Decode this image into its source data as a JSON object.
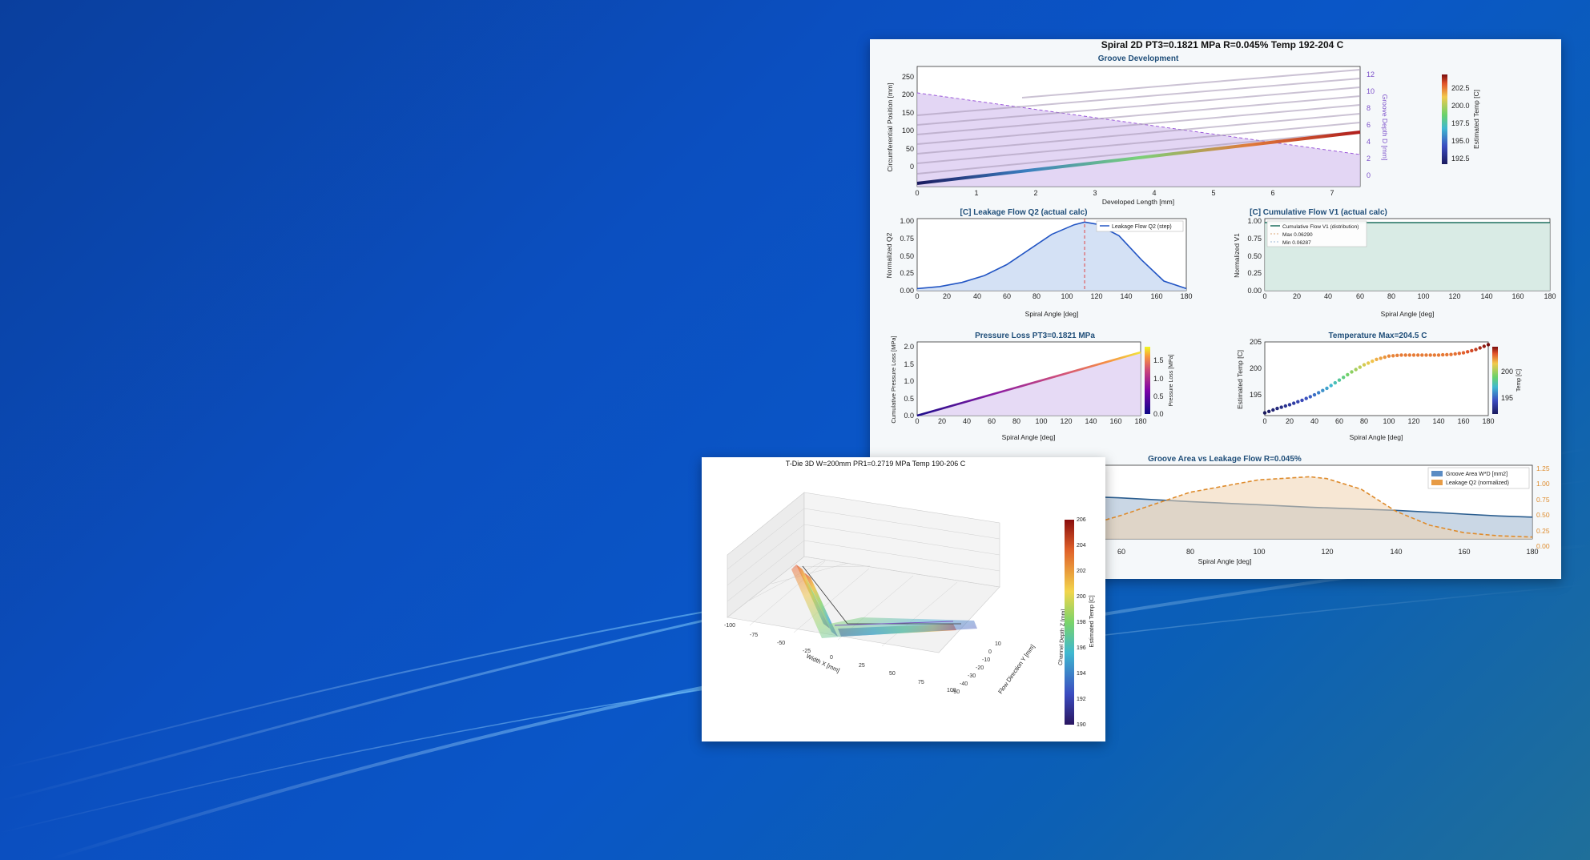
{
  "desktop": {
    "background": "#0b4fc0"
  },
  "spiral": {
    "title": "Spiral 2D  PT3=0.1821 MPa  R=0.045%  Temp 192-204 C",
    "groove": {
      "title": "Groove Development",
      "xlabel": "Developed Length [mm]",
      "ylabel": "Circumferential Position [mm]",
      "y2label": "Groove Depth D [mm]",
      "cbar_label": "Estimated Temp [C]",
      "xticks": [
        "0",
        "1",
        "2",
        "3",
        "4",
        "5",
        "6",
        "7"
      ],
      "yticks": [
        "0",
        "50",
        "100",
        "150",
        "200",
        "250"
      ],
      "y2ticks": [
        "0",
        "2",
        "4",
        "6",
        "8",
        "10",
        "12"
      ],
      "cbar_ticks": [
        "192.5",
        "195.0",
        "197.5",
        "200.0",
        "202.5"
      ]
    },
    "q2": {
      "title": "[C] Leakage Flow Q2 (actual calc)",
      "xlabel": "Spiral Angle [deg]",
      "ylabel": "Normalized Q2",
      "legend": "Leakage Flow Q2 (step)",
      "xticks": [
        "0",
        "20",
        "40",
        "60",
        "80",
        "100",
        "120",
        "140",
        "160",
        "180"
      ],
      "yticks": [
        "0.00",
        "0.25",
        "0.50",
        "0.75",
        "1.00"
      ]
    },
    "v1": {
      "title": "[C] Cumulative Flow V1 (actual calc)",
      "xlabel": "Spiral Angle [deg]",
      "ylabel": "Normalized V1",
      "legend": [
        "Cumulative Flow V1 (distribution)",
        "Max 0.06290",
        "Min 0.06287"
      ],
      "xticks": [
        "0",
        "20",
        "40",
        "60",
        "80",
        "100",
        "120",
        "140",
        "160",
        "180"
      ],
      "yticks": [
        "0.00",
        "0.25",
        "0.50",
        "0.75",
        "1.00"
      ]
    },
    "ploss": {
      "title": "Pressure Loss  PT3=0.1821 MPa",
      "xlabel": "Spiral Angle [deg]",
      "ylabel": "Cumulative Pressure Loss [MPa]",
      "cbar_label": "Pressure Loss [MPa]",
      "xticks": [
        "0",
        "20",
        "40",
        "60",
        "80",
        "100",
        "120",
        "140",
        "160",
        "180"
      ],
      "yticks": [
        "0.0",
        "0.5",
        "1.0",
        "1.5",
        "2.0"
      ],
      "cbar_ticks": [
        "0.0",
        "0.5",
        "1.0",
        "1.5"
      ]
    },
    "temp": {
      "title": "Temperature  Max=204.5 C",
      "xlabel": "Spiral Angle [deg]",
      "ylabel": "Estimated Temp [C]",
      "cbar_label": "Temp [C]",
      "xticks": [
        "0",
        "20",
        "40",
        "60",
        "80",
        "100",
        "120",
        "140",
        "160",
        "180"
      ],
      "yticks": [
        "195",
        "200",
        "205"
      ],
      "cbar_ticks": [
        "195",
        "200"
      ]
    },
    "area": {
      "title": "Groove Area vs Leakage Flow  R=0.045%",
      "xlabel": "Spiral Angle [deg]",
      "legend": [
        "Groove Area W*D [mm2]",
        "Leakage Q2 (normalized)"
      ],
      "xticks": [
        "60",
        "80",
        "100",
        "120",
        "140",
        "160",
        "180"
      ],
      "y2ticks": [
        "0.00",
        "0.25",
        "0.50",
        "0.75",
        "1.00",
        "1.25"
      ]
    }
  },
  "tdie": {
    "title": "T-Die 3D  W=200mm  PR1=0.2719 MPa  Temp 190-206 C",
    "xlabel": "Width X [mm]",
    "ylabel": "Flow Direction Y [mm]",
    "zlabel": "Channel Depth Z [mm]",
    "cbar_label": "Estimated Temp [C]",
    "xticks": [
      "-100",
      "-75",
      "-50",
      "-25",
      "0",
      "25",
      "50",
      "75",
      "100"
    ],
    "yticks": [
      "-50",
      "-40",
      "-30",
      "-20",
      "-10",
      "0",
      "10"
    ],
    "cbar_ticks": [
      "190",
      "192",
      "194",
      "196",
      "198",
      "200",
      "202",
      "204",
      "206"
    ]
  },
  "chart_data": [
    {
      "type": "line",
      "title": "[C] Leakage Flow Q2 (actual calc)",
      "xlabel": "Spiral Angle [deg]",
      "ylabel": "Normalized Q2",
      "x": [
        0,
        15,
        30,
        45,
        60,
        75,
        90,
        105,
        112,
        120,
        135,
        150,
        165,
        180
      ],
      "series": [
        {
          "name": "Leakage Flow Q2 (step)",
          "values": [
            0.03,
            0.06,
            0.12,
            0.22,
            0.38,
            0.6,
            0.82,
            0.96,
            1.0,
            0.97,
            0.8,
            0.45,
            0.14,
            0.03
          ]
        }
      ],
      "xlim": [
        0,
        180
      ],
      "ylim": [
        0,
        1.05
      ],
      "marker_x": 112
    },
    {
      "type": "line",
      "title": "[C] Cumulative Flow V1 (actual calc)",
      "xlabel": "Spiral Angle [deg]",
      "ylabel": "Normalized V1",
      "x": [
        0,
        180
      ],
      "series": [
        {
          "name": "Cumulative Flow V1 (distribution)",
          "values": [
            1.0,
            1.0
          ]
        }
      ],
      "xlim": [
        0,
        180
      ],
      "ylim": [
        0,
        1.05
      ]
    },
    {
      "type": "line",
      "title": "Pressure Loss  PT3=0.1821 MPa",
      "xlabel": "Spiral Angle [deg]",
      "ylabel": "Cumulative Pressure Loss [MPa]",
      "x": [
        0,
        180
      ],
      "series": [
        {
          "values": [
            0.0,
            1.85
          ]
        }
      ],
      "xlim": [
        0,
        180
      ],
      "ylim": [
        0,
        2.1
      ]
    },
    {
      "type": "scatter",
      "title": "Temperature  Max=204.5 C",
      "xlabel": "Spiral Angle [deg]",
      "ylabel": "Estimated Temp [C]",
      "x": [
        0,
        10,
        20,
        30,
        40,
        50,
        60,
        70,
        80,
        90,
        100,
        110,
        120,
        130,
        140,
        150,
        160,
        170,
        180
      ],
      "series": [
        {
          "values": [
            192,
            192.8,
            193.5,
            194.3,
            195.3,
            196.5,
            198,
            199.5,
            200.8,
            201.8,
            202.4,
            202.6,
            202.6,
            202.6,
            202.6,
            202.7,
            203,
            203.6,
            204.5
          ]
        }
      ],
      "xlim": [
        0,
        180
      ],
      "ylim": [
        191.5,
        205
      ]
    },
    {
      "type": "area",
      "title": "Groove Area vs Leakage Flow  R=0.045%",
      "xlabel": "Spiral Angle [deg]",
      "x": [
        50,
        60,
        80,
        100,
        115,
        120,
        130,
        140,
        150,
        160,
        170,
        180
      ],
      "series": [
        {
          "name": "Groove Area W*D [mm2]",
          "values": [
            0.68,
            0.66,
            0.6,
            0.55,
            0.51,
            0.5,
            0.48,
            0.46,
            0.43,
            0.4,
            0.37,
            0.35
          ]
        },
        {
          "name": "Leakage Q2 (normalized)",
          "values": [
            0.22,
            0.38,
            0.75,
            0.95,
            1.0,
            0.97,
            0.8,
            0.45,
            0.22,
            0.1,
            0.05,
            0.03
          ]
        }
      ],
      "xlim": [
        50,
        180
      ],
      "y2lim": [
        0,
        1.25
      ]
    }
  ]
}
